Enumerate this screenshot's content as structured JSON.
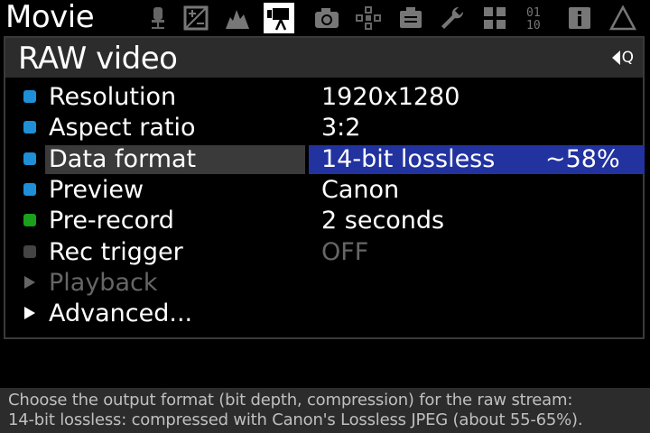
{
  "app": {
    "tab_title": "Movie"
  },
  "tabs": [
    {
      "icon": "microphone-icon",
      "active": false
    },
    {
      "icon": "exposure-icon",
      "active": false
    },
    {
      "icon": "histogram-icon",
      "active": false
    },
    {
      "icon": "movie-camera-icon",
      "active": true
    },
    {
      "icon": "camera-icon",
      "active": false
    },
    {
      "icon": "focus-icon",
      "active": false
    },
    {
      "icon": "display-icon",
      "active": false
    },
    {
      "icon": "wrench-icon",
      "active": false
    },
    {
      "icon": "modules-icon",
      "active": false
    },
    {
      "icon": "debug-icon",
      "active": false
    },
    {
      "icon": "info-icon",
      "active": false
    },
    {
      "icon": "warning-icon",
      "active": false
    }
  ],
  "panel": {
    "title": "RAW video",
    "zoom_hint": "Q",
    "items": [
      {
        "label": "Resolution",
        "value": "1920x1280",
        "extra": "",
        "status": "blue",
        "selected": false
      },
      {
        "label": "Aspect ratio",
        "value": "3:2",
        "extra": "",
        "status": "blue",
        "selected": false
      },
      {
        "label": "Data format",
        "value": "14-bit lossless",
        "extra": "~58%",
        "status": "blue",
        "selected": true
      },
      {
        "label": "Preview",
        "value": "Canon",
        "extra": "",
        "status": "blue",
        "selected": false
      },
      {
        "label": "Pre-record",
        "value": "2 seconds",
        "extra": "",
        "status": "green",
        "selected": false
      },
      {
        "label": "Rec trigger",
        "value": "OFF",
        "extra": "",
        "status": "gray",
        "selected": false
      },
      {
        "label": "Playback",
        "value": "",
        "extra": "",
        "status": "submenu-disabled",
        "selected": false
      },
      {
        "label": "Advanced...",
        "value": "",
        "extra": "",
        "status": "submenu",
        "selected": false
      }
    ]
  },
  "help": {
    "line1": "Choose the output format (bit depth, compression) for the raw stream:",
    "line2": "14-bit lossless: compressed with Canon's Lossless JPEG (about 55-65%)."
  },
  "colors": {
    "blue": "#1f8fd8",
    "green": "#1aa01a",
    "gray": "#444444",
    "selected_value_bg": "#2233a0",
    "selected_label_bg": "#3a3a3a",
    "disabled_text": "#666666"
  }
}
